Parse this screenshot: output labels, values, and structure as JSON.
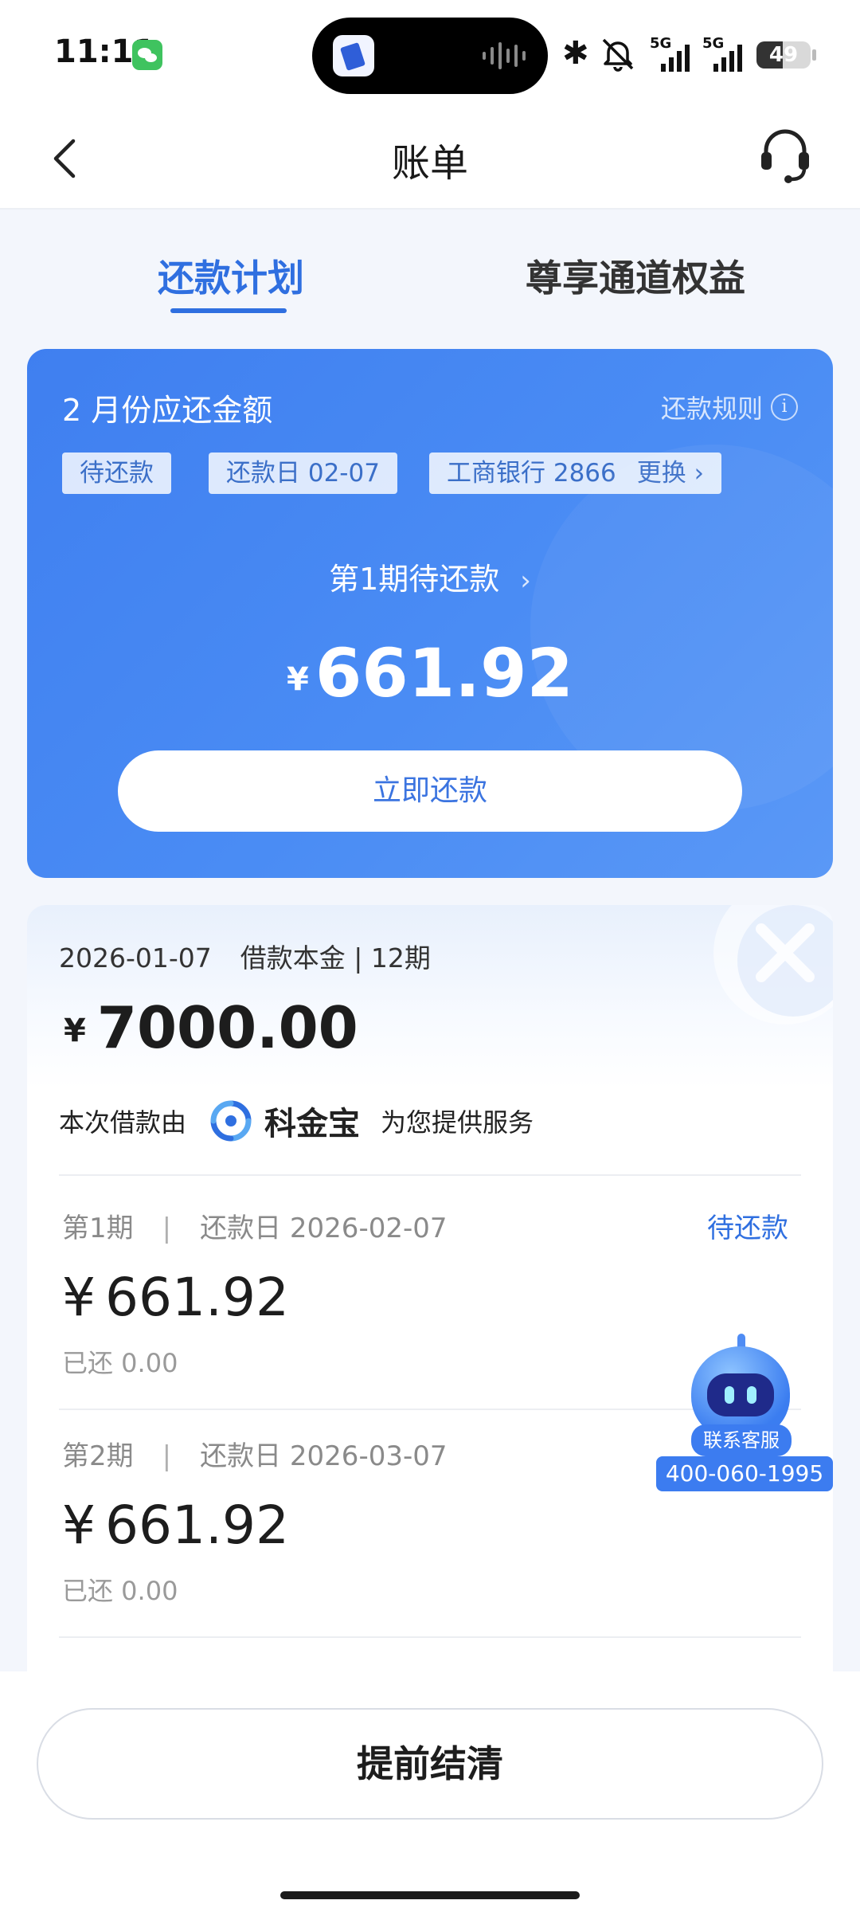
{
  "status_bar": {
    "time": "11:11",
    "signal_1_label": "5G",
    "signal_2_label": "5G",
    "battery": "49",
    "battery_level": 0.49,
    "icons": [
      "wechat-icon",
      "app-icon",
      "audio-wave-icon",
      "bluetooth-icon",
      "mute-icon",
      "signal-icon",
      "battery-icon"
    ]
  },
  "nav": {
    "title": "账单",
    "back_icon": "chevron-left-icon",
    "service_icon": "headset-icon"
  },
  "tabs": [
    {
      "label": "还款计划",
      "active": true
    },
    {
      "label": "尊享通道权益",
      "active": false
    }
  ],
  "due_card": {
    "title": "2 月份应还金额",
    "rules_label": "还款规则",
    "chips": {
      "status": "待还款",
      "due_date": "还款日 02-07",
      "bank": "工商银行 2866",
      "change": "更换 ›"
    },
    "period_link": "第1期待还款",
    "currency": "¥",
    "amount": "661.92",
    "pay_button": "立即还款"
  },
  "loan": {
    "date": "2026-01-07",
    "summary": "借款本金 | 12期",
    "currency": "¥",
    "principal": "7000.00",
    "provider_prefix": "本次借款由",
    "provider_name": "科金宝",
    "provider_suffix": "为您提供服务"
  },
  "installments": [
    {
      "period": "第1期",
      "separator": "|",
      "due_date": "还款日 2026-02-07",
      "status": "待还款",
      "currency": "¥",
      "amount": "661.92",
      "paid": "已还 0.00"
    },
    {
      "period": "第2期",
      "separator": "|",
      "due_date": "还款日 2026-03-07",
      "status": "",
      "currency": "¥",
      "amount": "661.92",
      "paid": "已还 0.00"
    }
  ],
  "assistant": {
    "label": "联系客服",
    "phone": "400-060-1995"
  },
  "bottom": {
    "settle_button": "提前结清"
  },
  "colors": {
    "accent": "#2f6fe0",
    "card_gradient_start": "#3f7ff0",
    "card_gradient_end": "#5a98f6",
    "page_background": "#f3f6fc"
  }
}
